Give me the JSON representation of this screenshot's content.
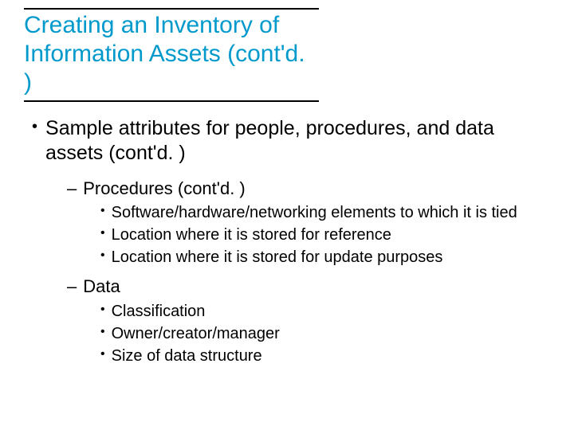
{
  "title": "Creating an Inventory of Information Assets (cont'd. )",
  "l1": {
    "text": "Sample attributes for people, procedures, and data assets (cont'd. )"
  },
  "sections": [
    {
      "label": "Procedures (cont'd. )",
      "items": [
        "Software/hardware/networking elements to which it is tied",
        "Location where it is stored for reference",
        "Location where it is stored for update purposes"
      ]
    },
    {
      "label": "Data",
      "items": [
        "Classification",
        "Owner/creator/manager",
        "Size of data structure"
      ]
    }
  ]
}
